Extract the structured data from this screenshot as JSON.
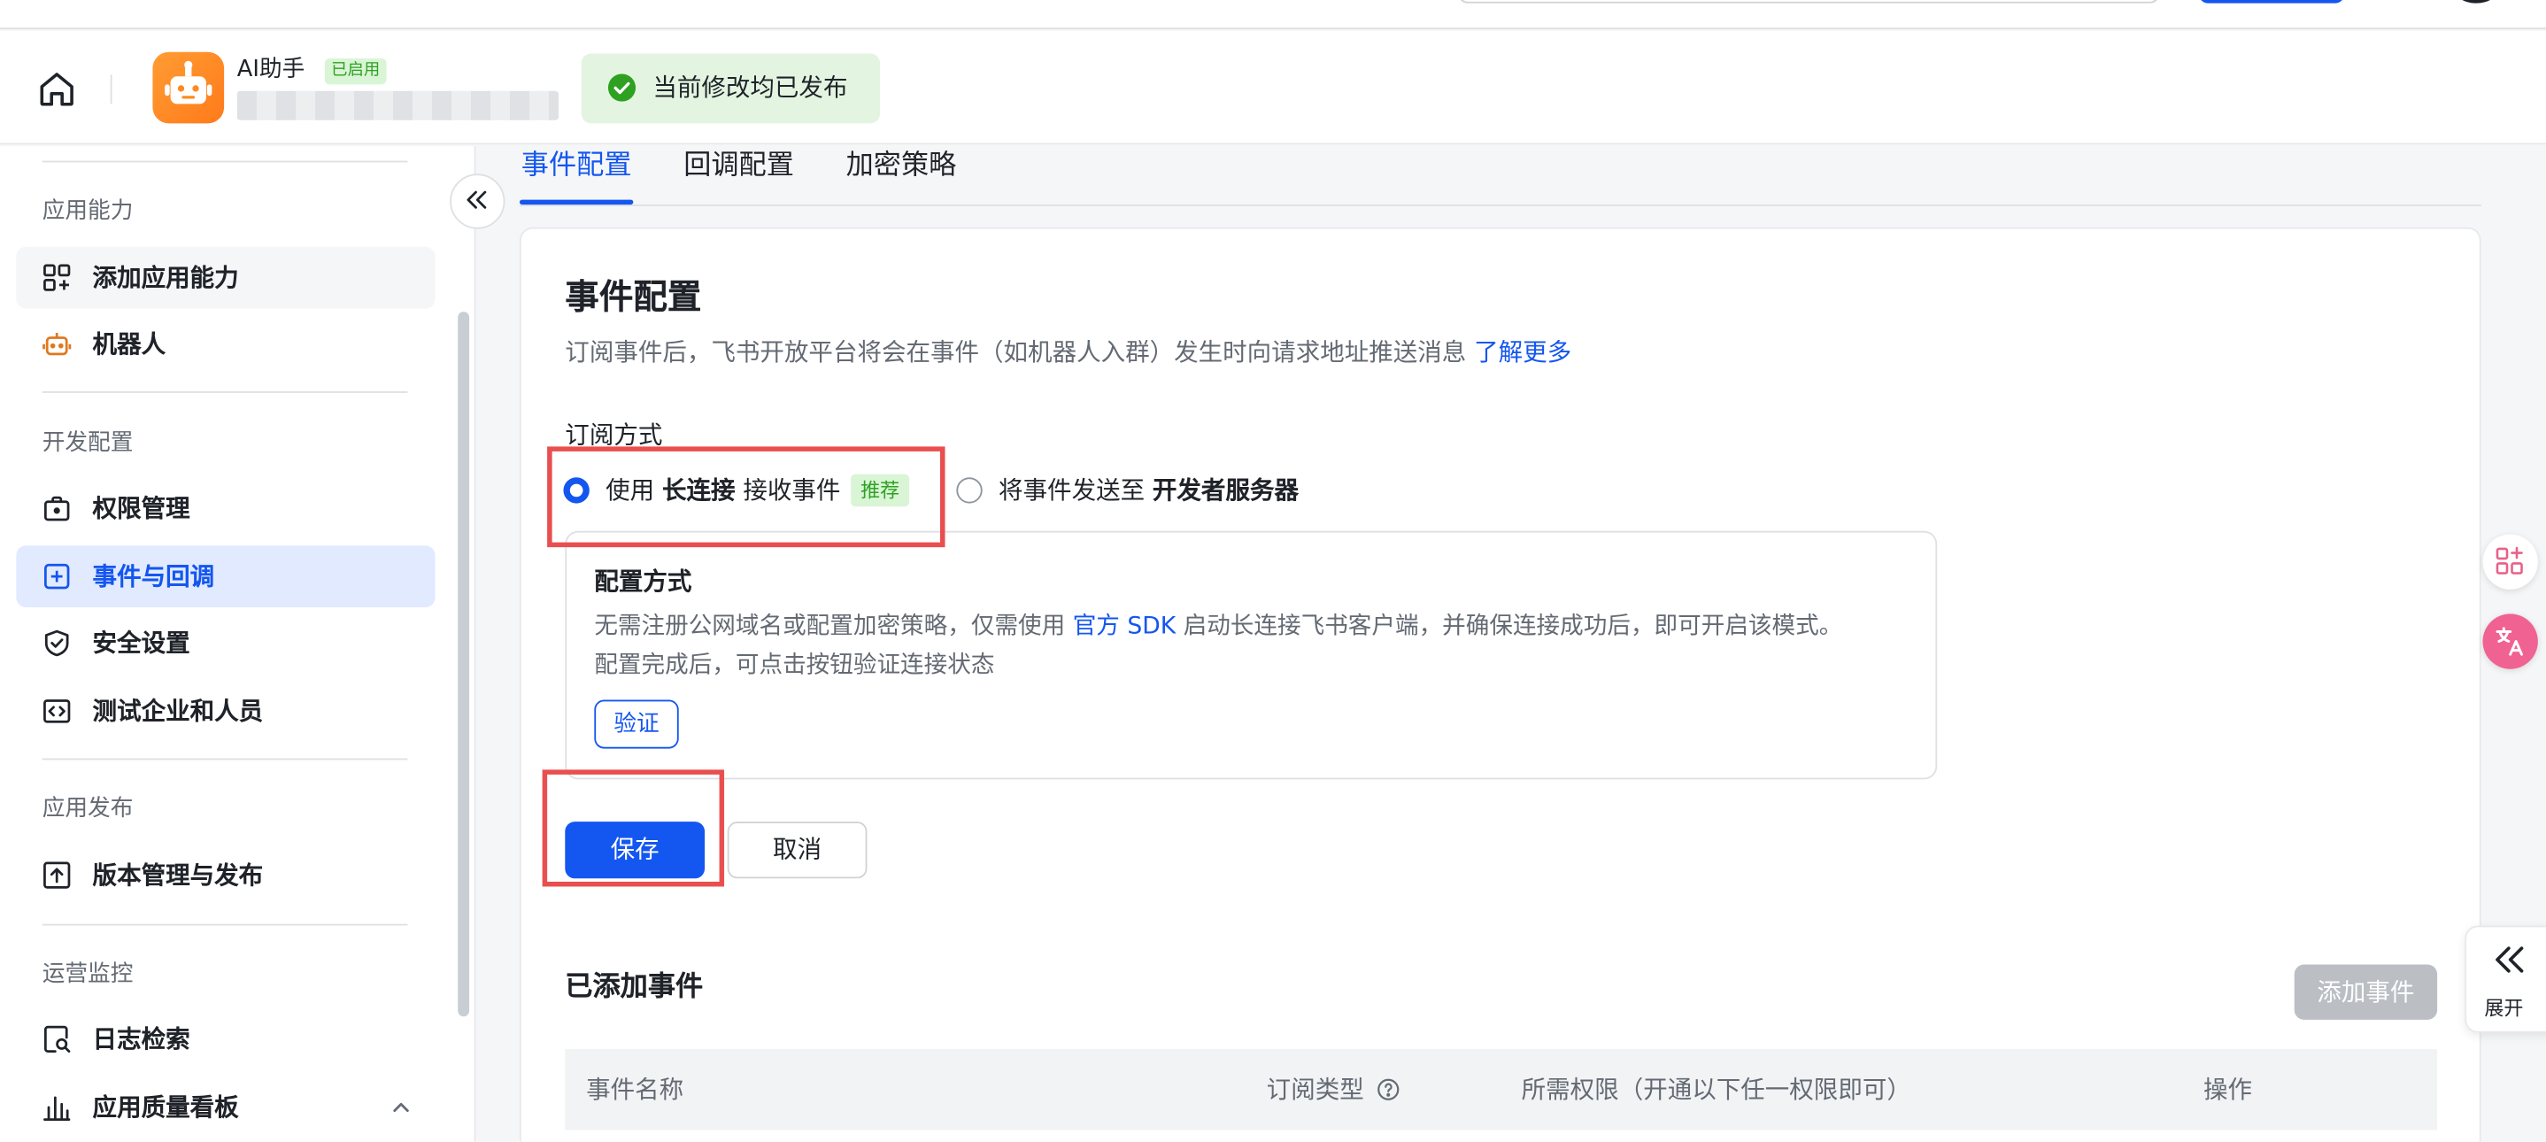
{
  "header": {
    "app_name": "AI助手",
    "app_status_badge": "已启用",
    "published_notice": "当前修改均已发布"
  },
  "sidebar": {
    "groups": {
      "capability": "应用能力",
      "dev": "开发配置",
      "release": "应用发布",
      "ops": "运营监控"
    },
    "items": [
      {
        "label": "添加应用能力",
        "icon": "grid-add-icon"
      },
      {
        "label": "机器人",
        "icon": "robot-icon"
      },
      {
        "label": "权限管理",
        "icon": "permission-icon"
      },
      {
        "label": "事件与回调",
        "icon": "event-callback-icon",
        "active": true
      },
      {
        "label": "安全设置",
        "icon": "shield-icon"
      },
      {
        "label": "测试企业和人员",
        "icon": "code-icon"
      },
      {
        "label": "版本管理与发布",
        "icon": "upload-icon"
      },
      {
        "label": "日志检索",
        "icon": "log-search-icon"
      },
      {
        "label": "应用质量看板",
        "icon": "bar-chart-icon"
      }
    ]
  },
  "tabs": [
    "事件配置",
    "回调配置",
    "加密策略"
  ],
  "card": {
    "title": "事件配置",
    "desc": "订阅事件后，飞书开放平台将会在事件（如机器人入群）发生时向请求地址推送消息",
    "desc_link": "了解更多",
    "subscribe_label": "订阅方式",
    "option1": {
      "pre": "使用",
      "bold": "长连接",
      "post": "接收事件",
      "badge": "推荐"
    },
    "option2": {
      "pre": "将事件发送至",
      "bold": "开发者服务器"
    },
    "config": {
      "title": "配置方式",
      "line1_pre": "无需注册公网域名或配置加密策略，仅需使用",
      "line1_link": "官方 SDK",
      "line1_post": "启动长连接飞书客户端，并确保连接成功后，即可开启该模式。",
      "line2": "配置完成后，可点击按钮验证连接状态",
      "verify": "验证"
    },
    "save": "保存",
    "cancel": "取消",
    "added_title": "已添加事件",
    "add_event": "添加事件",
    "table_headers": [
      "事件名称",
      "订阅类型",
      "所需权限（开通以下任一权限即可）",
      "操作"
    ]
  },
  "right": {
    "expand_label": "展开"
  },
  "colors": {
    "primary": "#1456f0",
    "success": "#2ea121",
    "highlight": "#e94f4f",
    "app_icon": "#ff8a1f"
  }
}
